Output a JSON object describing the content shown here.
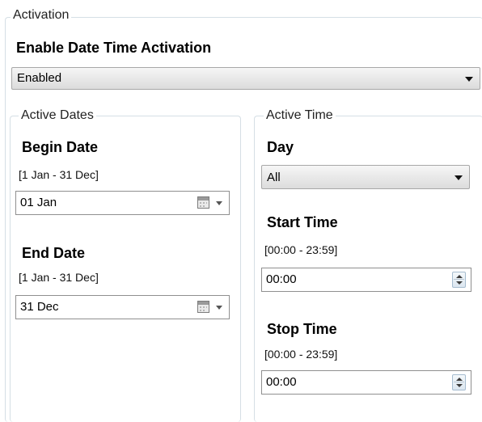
{
  "activation": {
    "group_title": "Activation",
    "enable_label": "Enable Date Time Activation",
    "enable_value": "Enabled"
  },
  "active_dates": {
    "group_title": "Active Dates",
    "begin": {
      "label": "Begin Date",
      "hint": "[1 Jan - 31 Dec]",
      "value": "01 Jan"
    },
    "end": {
      "label": "End Date",
      "hint": "[1 Jan - 31 Dec]",
      "value": "31 Dec"
    }
  },
  "active_time": {
    "group_title": "Active Time",
    "day": {
      "label": "Day",
      "value": "All"
    },
    "start": {
      "label": "Start Time",
      "hint": "[00:00 - 23:59]",
      "value": "00:00"
    },
    "stop": {
      "label": "Stop Time",
      "hint": "[00:00 - 23:59]",
      "value": "00:00"
    }
  },
  "icons": {
    "dropdown": "chevron-down-icon",
    "calendar": "calendar-icon",
    "spinner": "spinner-updown-icon"
  }
}
